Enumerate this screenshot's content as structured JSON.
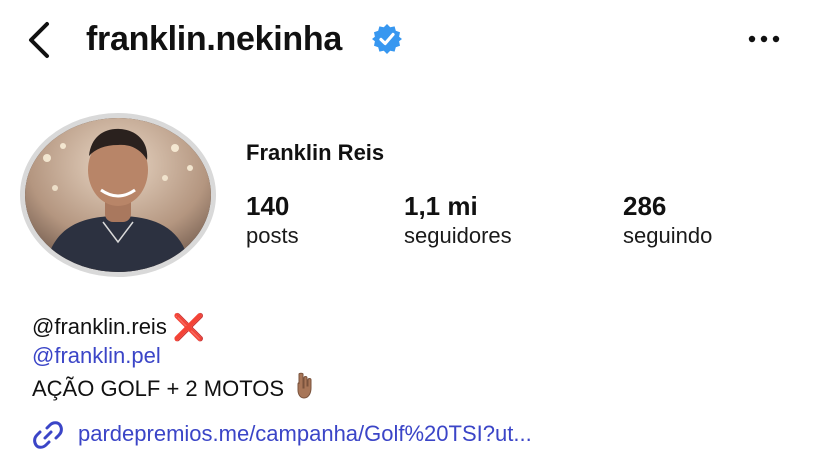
{
  "header": {
    "username": "franklin.nekinha",
    "back_icon": "chevron-left-icon",
    "verified_icon": "verified-badge-icon",
    "more_icon": "more-horizontal-icon"
  },
  "profile": {
    "full_name": "Franklin Reis",
    "stats": [
      {
        "value": "140",
        "label": "posts"
      },
      {
        "value": "1,1 mi",
        "label": "seguidores"
      },
      {
        "value": "286",
        "label": "seguindo"
      }
    ]
  },
  "bio": {
    "handle": "@franklin.reis",
    "handle_emoji": "❌",
    "mention": "@franklin.pel",
    "text": "AÇÃO GOLF + 2 MOTOS",
    "text_emoji": "pointing-down-hand-icon",
    "link": "pardepremios.me/campanha/Golf%20TSI?ut...",
    "link_icon": "link-icon"
  },
  "colors": {
    "verified_blue": "#3797f0",
    "link_blue": "#3b45c7",
    "avatar_ring": "#d9d9d9",
    "x_red": "#e0231c"
  }
}
